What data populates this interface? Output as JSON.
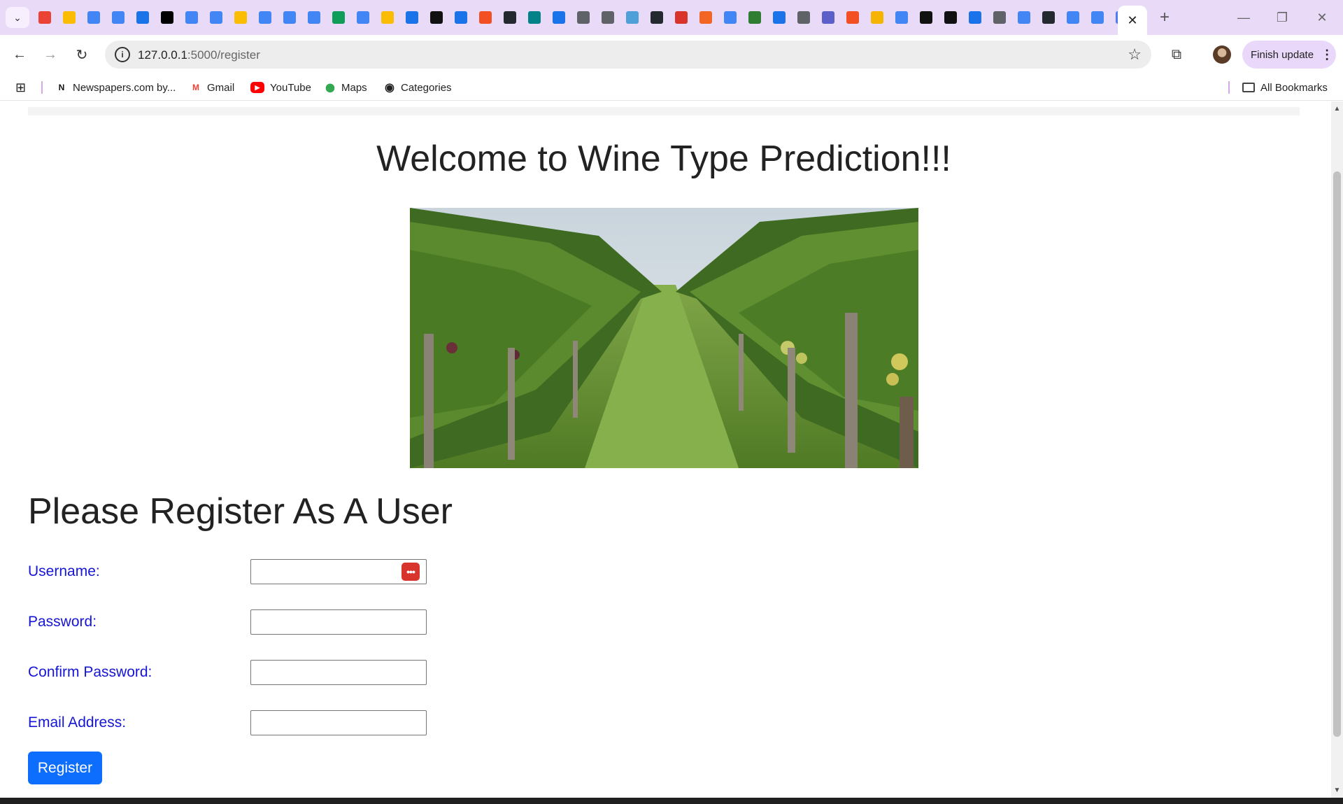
{
  "browser": {
    "active_tab_close": "✕",
    "new_tab": "+",
    "window_controls": {
      "minimize": "—",
      "restore": "❐",
      "close": "✕"
    },
    "url_host": "127.0.0.1",
    "url_rest": ":5000/register",
    "finish_update_label": "Finish update",
    "menu_dots": "⋮",
    "tab_favicons": [
      {
        "name": "gmail-favicon",
        "color": "#ea4335"
      },
      {
        "name": "drive-favicon",
        "color": "#fbbc04"
      },
      {
        "name": "docs-favicon",
        "color": "#4285f4"
      },
      {
        "name": "docs-favicon",
        "color": "#4285f4"
      },
      {
        "name": "chat-favicon",
        "color": "#1a73e8"
      },
      {
        "name": "medium-favicon",
        "color": "#000000"
      },
      {
        "name": "calendar-favicon",
        "color": "#4285f4"
      },
      {
        "name": "docs-favicon",
        "color": "#4285f4"
      },
      {
        "name": "slides-favicon",
        "color": "#fbbc04"
      },
      {
        "name": "docs-favicon",
        "color": "#4285f4"
      },
      {
        "name": "docs-favicon",
        "color": "#4285f4"
      },
      {
        "name": "docs-favicon",
        "color": "#4285f4"
      },
      {
        "name": "sheets-favicon",
        "color": "#0f9d58"
      },
      {
        "name": "docs-favicon",
        "color": "#4285f4"
      },
      {
        "name": "slides-favicon",
        "color": "#fbbc04"
      },
      {
        "name": "arrow-favicon",
        "color": "#1a73e8"
      },
      {
        "name": "c-favicon",
        "color": "#111111"
      },
      {
        "name": "a-favicon",
        "color": "#1a73e8"
      },
      {
        "name": "microsoft-favicon",
        "color": "#f25022"
      },
      {
        "name": "github-favicon",
        "color": "#24292f"
      },
      {
        "name": "sharepoint-favicon",
        "color": "#038387"
      },
      {
        "name": "a-favicon",
        "color": "#1a73e8"
      },
      {
        "name": "globe-favicon",
        "color": "#5f6368"
      },
      {
        "name": "image-favicon",
        "color": "#5f6368"
      },
      {
        "name": "cloud-favicon",
        "color": "#4fa0d8"
      },
      {
        "name": "github-favicon",
        "color": "#24292f"
      },
      {
        "name": "password-favicon",
        "color": "#d9342b"
      },
      {
        "name": "t-favicon",
        "color": "#f26522"
      },
      {
        "name": "docs-favicon",
        "color": "#4285f4"
      },
      {
        "name": "tree-favicon",
        "color": "#2e7d32"
      },
      {
        "name": "eye-favicon",
        "color": "#1a73e8"
      },
      {
        "name": "globe-favicon",
        "color": "#5f6368"
      },
      {
        "name": "teams-favicon",
        "color": "#5b5fc7"
      },
      {
        "name": "microsoft-favicon",
        "color": "#f25022"
      },
      {
        "name": "w-favicon",
        "color": "#f4b400"
      },
      {
        "name": "google-favicon",
        "color": "#4285f4"
      },
      {
        "name": "vs-favicon",
        "color": "#111111"
      },
      {
        "name": "g-favicon",
        "color": "#111111"
      },
      {
        "name": "arrow-favicon",
        "color": "#1a73e8"
      },
      {
        "name": "globe-favicon",
        "color": "#5f6368"
      },
      {
        "name": "google-favicon",
        "color": "#4285f4"
      },
      {
        "name": "github-favicon",
        "color": "#24292f"
      },
      {
        "name": "google-favicon",
        "color": "#4285f4"
      },
      {
        "name": "google-favicon",
        "color": "#4285f4"
      },
      {
        "name": "gemini-favicon",
        "color": "#4b7bf5"
      }
    ]
  },
  "bookmarks": {
    "items": [
      {
        "label": "Newspapers.com by...",
        "icon": "N",
        "color": "#111111"
      },
      {
        "label": "Gmail",
        "icon": "M",
        "color": "#ea4335"
      },
      {
        "label": "YouTube",
        "icon": "▶",
        "color": "#ff0000"
      },
      {
        "label": "Maps",
        "icon": "📍",
        "color": "#34a853"
      },
      {
        "label": "Categories",
        "icon": "◉",
        "color": "#222222"
      }
    ],
    "all_bookmarks_label": "All Bookmarks"
  },
  "page": {
    "welcome_title": "Welcome to Wine Type Prediction!!!",
    "register_title": "Please Register As A User",
    "form": {
      "username_label": "Username:",
      "username_value": "",
      "password_label": "Password:",
      "password_value": "",
      "confirm_password_label": "Confirm Password:",
      "confirm_password_value": "",
      "email_label": "Email Address:",
      "email_value": "",
      "submit_label": "Register"
    },
    "colors": {
      "label": "#1515d6",
      "button": "#0d6efd",
      "tabstrip": "#e9daf7"
    }
  }
}
